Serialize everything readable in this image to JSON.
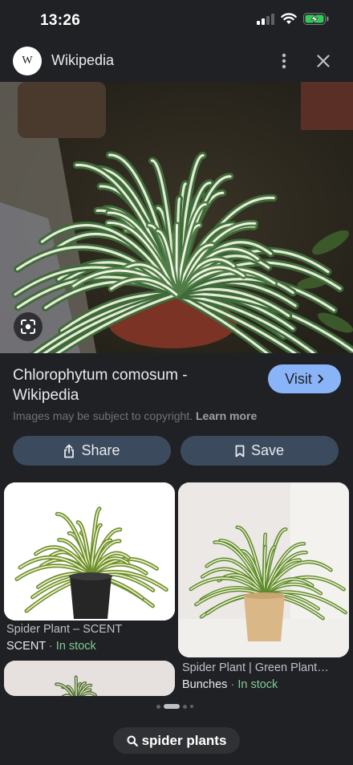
{
  "status_bar": {
    "time": "13:26"
  },
  "header": {
    "logo_text": "W",
    "site_name": "Wikipedia"
  },
  "result": {
    "title": "Chlorophytum comosum - Wikipedia",
    "visit_label": "Visit",
    "copyright_text": "Images may be subject to copyright.",
    "learn_more": "Learn more",
    "share_label": "Share",
    "save_label": "Save"
  },
  "related": [
    {
      "title": "Spider Plant – SCENT",
      "source": "SCENT",
      "separator": "·",
      "availability": "In stock"
    },
    {
      "title": "Spider Plant | Green Plant…",
      "source": "Bunches",
      "separator": "·",
      "availability": "In stock"
    }
  ],
  "query": {
    "text": "spider plants"
  },
  "colors": {
    "accent": "#8ab4f8",
    "background": "#202124",
    "button": "#3c4a5e",
    "in_stock": "#81c995"
  },
  "icons": [
    "wifi-icon",
    "battery-charging-icon",
    "more-vert-icon",
    "close-icon",
    "lens-icon",
    "chevron-right-icon",
    "share-icon",
    "bookmark-icon",
    "search-icon"
  ]
}
